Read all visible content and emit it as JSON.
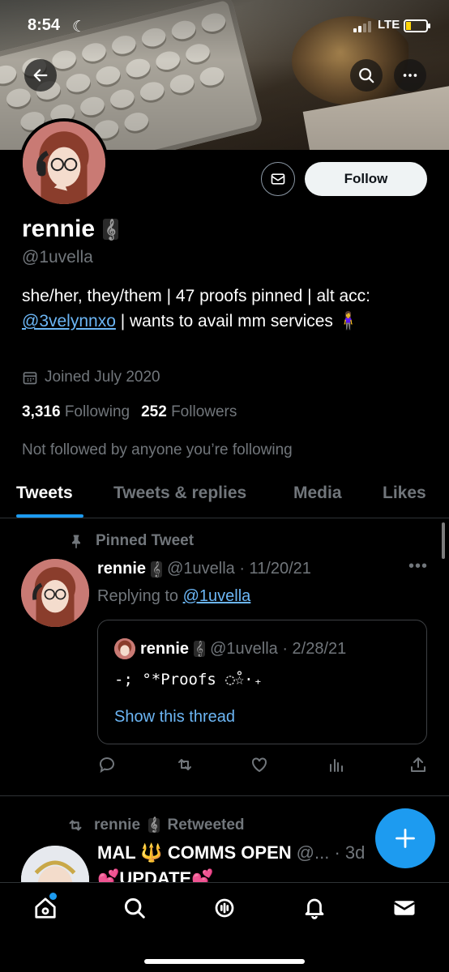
{
  "status_bar": {
    "time": "8:54",
    "network": "LTE"
  },
  "profile": {
    "name": "rennie",
    "handle": "@1uvella",
    "bio_part1": "she/her, they/them | 47 proofs pinned | alt acc: ",
    "bio_link": "@3velynnxo",
    "bio_part2": " | wants to avail mm services ",
    "bio_emoji": "🧍‍♀️",
    "joined": "Joined July 2020",
    "following_count": "3,316",
    "following_label": "Following",
    "followers_count": "252",
    "followers_label": "Followers",
    "not_followed_text": "Not followed by anyone you’re following",
    "follow_label": "Follow"
  },
  "tabs": [
    "Tweets",
    "Tweets & replies",
    "Media",
    "Likes"
  ],
  "pinned_tweet": {
    "pinned_label": "Pinned Tweet",
    "author": "rennie",
    "handle_date": "@1uvella · 11/20/21",
    "replying_prefix": "Replying to ",
    "replying_to": "@1uvella",
    "quote": {
      "author": "rennie",
      "handle_date": "@1uvella · 2/28/21",
      "text": "-; °*Proofs ◌̊☆·₊",
      "show_thread": "Show this thread"
    }
  },
  "retweet": {
    "retweeted_by": "rennie",
    "retweeted_label": "Retweeted",
    "author_name": "MAL 🔱 COMMS OPEN",
    "author_handle": "@... · 3d",
    "text_line": "💕UPDATE💕"
  },
  "colors": {
    "accent": "#1d9bf0",
    "link": "#6cb6f5",
    "muted": "#71767b"
  }
}
